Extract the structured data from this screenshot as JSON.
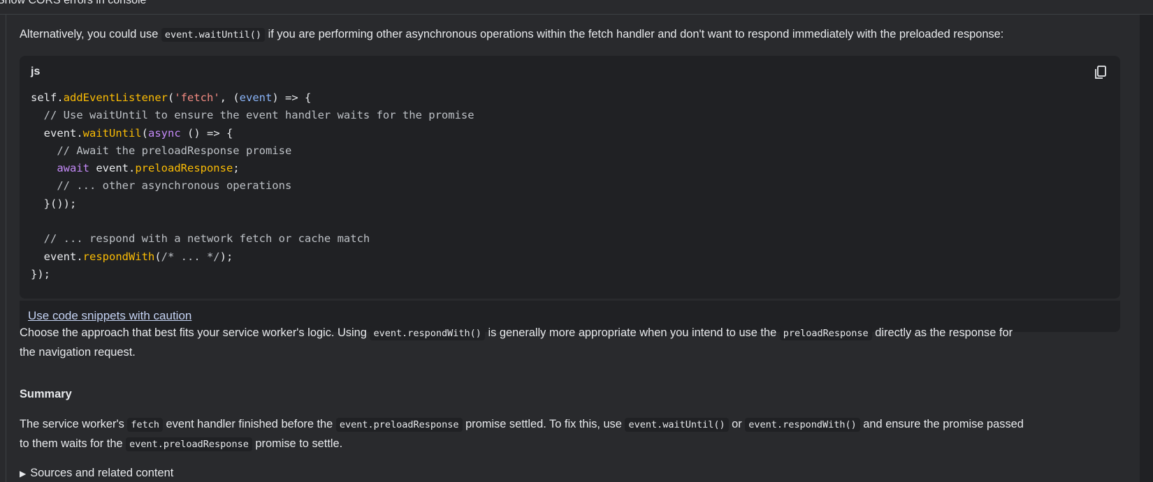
{
  "top": {
    "partial_label": "Show CORS errors in console"
  },
  "intro": {
    "before": "Alternatively, you could use ",
    "code": "event.waitUntil()",
    "after": " if you are performing other asynchronous operations within the fetch handler and don't want to respond immediately with the preloaded response:"
  },
  "codeblock": {
    "language": "js",
    "copy_icon": "copy-icon",
    "lines": [
      [
        {
          "t": "self."
        },
        {
          "t": "addEventListener",
          "c": "fn"
        },
        {
          "t": "("
        },
        {
          "t": "'fetch'",
          "c": "str"
        },
        {
          "t": ", ("
        },
        {
          "t": "event",
          "c": "param"
        },
        {
          "t": ") => {"
        }
      ],
      [
        {
          "t": "  // Use waitUntil to ensure the event handler waits for the promise",
          "c": "cm"
        }
      ],
      [
        {
          "t": "  event."
        },
        {
          "t": "waitUntil",
          "c": "fn"
        },
        {
          "t": "("
        },
        {
          "t": "async",
          "c": "kw"
        },
        {
          "t": " () => {"
        }
      ],
      [
        {
          "t": "    // Await the preloadResponse promise",
          "c": "cm"
        }
      ],
      [
        {
          "t": "    "
        },
        {
          "t": "await",
          "c": "kw"
        },
        {
          "t": " event."
        },
        {
          "t": "preloadResponse",
          "c": "fn"
        },
        {
          "t": ";"
        }
      ],
      [
        {
          "t": "    // ... other asynchronous operations",
          "c": "cm"
        }
      ],
      [
        {
          "t": "  }());"
        }
      ],
      [
        {
          "t": ""
        }
      ],
      [
        {
          "t": "  // ... respond with a network fetch or cache match",
          "c": "cm"
        }
      ],
      [
        {
          "t": "  event."
        },
        {
          "t": "respondWith",
          "c": "fn"
        },
        {
          "t": "("
        },
        {
          "t": "/* ... */",
          "c": "cm"
        },
        {
          "t": ");"
        }
      ],
      [
        {
          "t": "});"
        }
      ]
    ]
  },
  "caution_link": "Use code snippets with caution",
  "choose": {
    "line1_before": "Choose the approach that best fits your service worker's logic. Using ",
    "code1": "event.respondWith()",
    "line1_mid": " is generally more appropriate when you intend to use the ",
    "code2": "preloadResponse",
    "line1_after": " directly as the response for",
    "line2": "the navigation request."
  },
  "summary_heading": "Summary",
  "summary": {
    "s1": "The service worker's ",
    "c1": "fetch",
    "s2": " event handler finished before the ",
    "c2": "event.preloadResponse",
    "s3": " promise settled. To fix this, use ",
    "c3": "event.waitUntil()",
    "s4": " or ",
    "c4": "event.respondWith()",
    "s5": " and ensure the promise passed",
    "s6": "to them waits for the ",
    "c5": "event.preloadResponse",
    "s7": " promise to settle."
  },
  "sources_toggle": "Sources and related content"
}
